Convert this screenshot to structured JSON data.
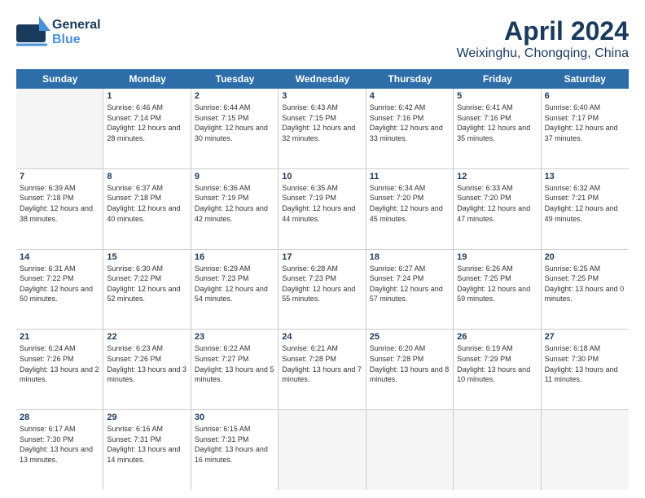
{
  "logo": {
    "line1": "General",
    "line2": "Blue"
  },
  "title": "April 2024",
  "subtitle": "Weixinghu, Chongqing, China",
  "calendar": {
    "headers": [
      "Sunday",
      "Monday",
      "Tuesday",
      "Wednesday",
      "Thursday",
      "Friday",
      "Saturday"
    ],
    "weeks": [
      [
        {
          "day": "",
          "empty": true
        },
        {
          "day": "1",
          "sunrise": "Sunrise: 6:46 AM",
          "sunset": "Sunset: 7:14 PM",
          "daylight": "Daylight: 12 hours and 28 minutes."
        },
        {
          "day": "2",
          "sunrise": "Sunrise: 6:44 AM",
          "sunset": "Sunset: 7:15 PM",
          "daylight": "Daylight: 12 hours and 30 minutes."
        },
        {
          "day": "3",
          "sunrise": "Sunrise: 6:43 AM",
          "sunset": "Sunset: 7:15 PM",
          "daylight": "Daylight: 12 hours and 32 minutes."
        },
        {
          "day": "4",
          "sunrise": "Sunrise: 6:42 AM",
          "sunset": "Sunset: 7:16 PM",
          "daylight": "Daylight: 12 hours and 33 minutes."
        },
        {
          "day": "5",
          "sunrise": "Sunrise: 6:41 AM",
          "sunset": "Sunset: 7:16 PM",
          "daylight": "Daylight: 12 hours and 35 minutes."
        },
        {
          "day": "6",
          "sunrise": "Sunrise: 6:40 AM",
          "sunset": "Sunset: 7:17 PM",
          "daylight": "Daylight: 12 hours and 37 minutes."
        }
      ],
      [
        {
          "day": "7",
          "sunrise": "Sunrise: 6:39 AM",
          "sunset": "Sunset: 7:18 PM",
          "daylight": "Daylight: 12 hours and 38 minutes."
        },
        {
          "day": "8",
          "sunrise": "Sunrise: 6:37 AM",
          "sunset": "Sunset: 7:18 PM",
          "daylight": "Daylight: 12 hours and 40 minutes."
        },
        {
          "day": "9",
          "sunrise": "Sunrise: 6:36 AM",
          "sunset": "Sunset: 7:19 PM",
          "daylight": "Daylight: 12 hours and 42 minutes."
        },
        {
          "day": "10",
          "sunrise": "Sunrise: 6:35 AM",
          "sunset": "Sunset: 7:19 PM",
          "daylight": "Daylight: 12 hours and 44 minutes."
        },
        {
          "day": "11",
          "sunrise": "Sunrise: 6:34 AM",
          "sunset": "Sunset: 7:20 PM",
          "daylight": "Daylight: 12 hours and 45 minutes."
        },
        {
          "day": "12",
          "sunrise": "Sunrise: 6:33 AM",
          "sunset": "Sunset: 7:20 PM",
          "daylight": "Daylight: 12 hours and 47 minutes."
        },
        {
          "day": "13",
          "sunrise": "Sunrise: 6:32 AM",
          "sunset": "Sunset: 7:21 PM",
          "daylight": "Daylight: 12 hours and 49 minutes."
        }
      ],
      [
        {
          "day": "14",
          "sunrise": "Sunrise: 6:31 AM",
          "sunset": "Sunset: 7:22 PM",
          "daylight": "Daylight: 12 hours and 50 minutes."
        },
        {
          "day": "15",
          "sunrise": "Sunrise: 6:30 AM",
          "sunset": "Sunset: 7:22 PM",
          "daylight": "Daylight: 12 hours and 52 minutes."
        },
        {
          "day": "16",
          "sunrise": "Sunrise: 6:29 AM",
          "sunset": "Sunset: 7:23 PM",
          "daylight": "Daylight: 12 hours and 54 minutes."
        },
        {
          "day": "17",
          "sunrise": "Sunrise: 6:28 AM",
          "sunset": "Sunset: 7:23 PM",
          "daylight": "Daylight: 12 hours and 55 minutes."
        },
        {
          "day": "18",
          "sunrise": "Sunrise: 6:27 AM",
          "sunset": "Sunset: 7:24 PM",
          "daylight": "Daylight: 12 hours and 57 minutes."
        },
        {
          "day": "19",
          "sunrise": "Sunrise: 6:26 AM",
          "sunset": "Sunset: 7:25 PM",
          "daylight": "Daylight: 12 hours and 59 minutes."
        },
        {
          "day": "20",
          "sunrise": "Sunrise: 6:25 AM",
          "sunset": "Sunset: 7:25 PM",
          "daylight": "Daylight: 13 hours and 0 minutes."
        }
      ],
      [
        {
          "day": "21",
          "sunrise": "Sunrise: 6:24 AM",
          "sunset": "Sunset: 7:26 PM",
          "daylight": "Daylight: 13 hours and 2 minutes."
        },
        {
          "day": "22",
          "sunrise": "Sunrise: 6:23 AM",
          "sunset": "Sunset: 7:26 PM",
          "daylight": "Daylight: 13 hours and 3 minutes."
        },
        {
          "day": "23",
          "sunrise": "Sunrise: 6:22 AM",
          "sunset": "Sunset: 7:27 PM",
          "daylight": "Daylight: 13 hours and 5 minutes."
        },
        {
          "day": "24",
          "sunrise": "Sunrise: 6:21 AM",
          "sunset": "Sunset: 7:28 PM",
          "daylight": "Daylight: 13 hours and 7 minutes."
        },
        {
          "day": "25",
          "sunrise": "Sunrise: 6:20 AM",
          "sunset": "Sunset: 7:28 PM",
          "daylight": "Daylight: 13 hours and 8 minutes."
        },
        {
          "day": "26",
          "sunrise": "Sunrise: 6:19 AM",
          "sunset": "Sunset: 7:29 PM",
          "daylight": "Daylight: 13 hours and 10 minutes."
        },
        {
          "day": "27",
          "sunrise": "Sunrise: 6:18 AM",
          "sunset": "Sunset: 7:30 PM",
          "daylight": "Daylight: 13 hours and 11 minutes."
        }
      ],
      [
        {
          "day": "28",
          "sunrise": "Sunrise: 6:17 AM",
          "sunset": "Sunset: 7:30 PM",
          "daylight": "Daylight: 13 hours and 13 minutes."
        },
        {
          "day": "29",
          "sunrise": "Sunrise: 6:16 AM",
          "sunset": "Sunset: 7:31 PM",
          "daylight": "Daylight: 13 hours and 14 minutes."
        },
        {
          "day": "30",
          "sunrise": "Sunrise: 6:15 AM",
          "sunset": "Sunset: 7:31 PM",
          "daylight": "Daylight: 13 hours and 16 minutes."
        },
        {
          "day": "",
          "empty": true
        },
        {
          "day": "",
          "empty": true
        },
        {
          "day": "",
          "empty": true
        },
        {
          "day": "",
          "empty": true
        }
      ]
    ]
  }
}
